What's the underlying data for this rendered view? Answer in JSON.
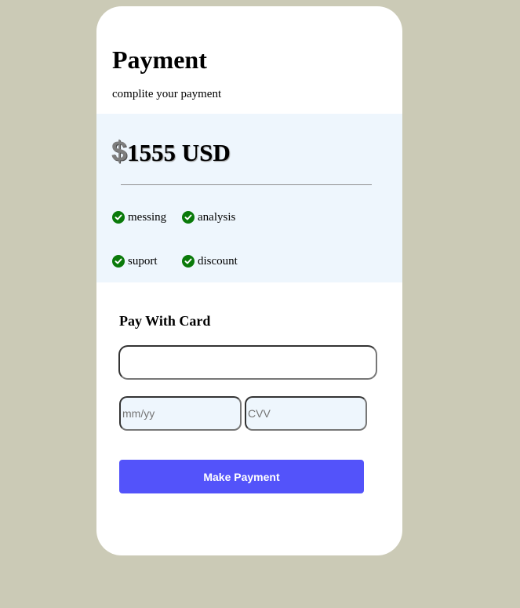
{
  "header": {
    "title": "Payment",
    "subtitle": "complite your payment"
  },
  "price": {
    "currency_symbol": "$",
    "amount": "1555 USD"
  },
  "features": [
    {
      "label": "messing",
      "icon": "check-circle-icon"
    },
    {
      "label": "analysis",
      "icon": "check-circle-icon"
    },
    {
      "label": "suport",
      "icon": "check-circle-icon"
    },
    {
      "label": "discount",
      "icon": "check-circle-icon"
    }
  ],
  "card_form": {
    "section_title": "Pay With Card",
    "card_number_value": "",
    "card_number_placeholder": "",
    "expiry_placeholder": "mm/yy",
    "cvv_placeholder": "CVV",
    "submit_label": "Make Payment"
  },
  "colors": {
    "page_background": "#cbcab6",
    "price_panel": "#eef6fd",
    "check_green": "#0a7a0a",
    "button": "#5353fa"
  }
}
